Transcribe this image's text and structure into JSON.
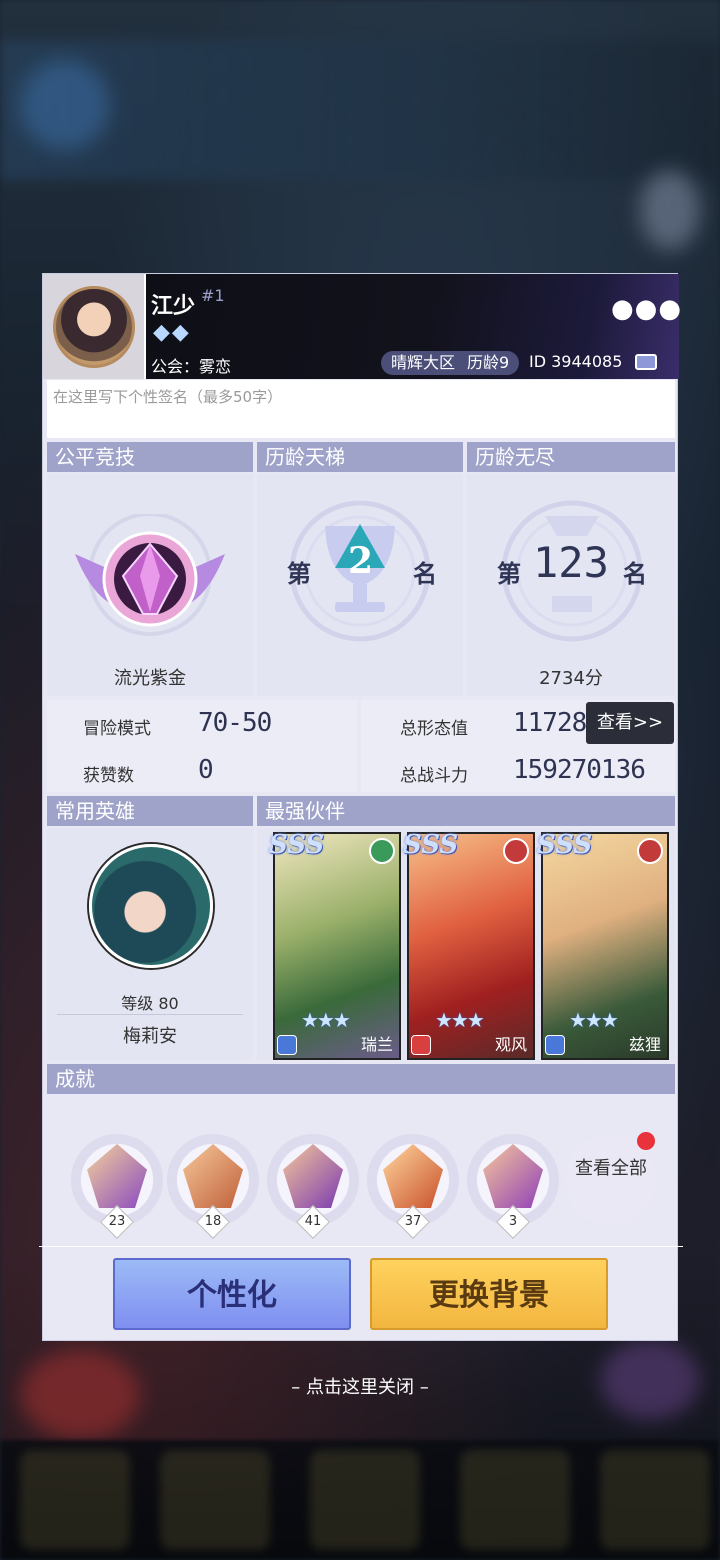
{
  "profile": {
    "name": "江少",
    "rank_no": "#1",
    "guild": "公会：雾恋",
    "server": "晴辉大区",
    "seasons": "历龄9",
    "user_id": "ID 3944085",
    "more_icon": "more-dots-icon",
    "signature_placeholder": "在这里写下个性签名（最多50字）"
  },
  "ranking": {
    "fair_title": "公平竞技",
    "ladder_title": "历龄天梯",
    "endless_title": "历龄无尽",
    "fair_tier": "流光紫金",
    "ladder_prefix": "第",
    "ladder_rank": "2",
    "ladder_suffix": "名",
    "endless_prefix": "第",
    "endless_rank": "123",
    "endless_suffix": "名",
    "endless_score": "2734分"
  },
  "stats": {
    "adventure_label": "冒险模式",
    "adventure_value": "70-50",
    "likes_label": "获赞数",
    "likes_value": "0",
    "forms_label": "总形态值",
    "forms_value": "11728",
    "power_label": "总战斗力",
    "power_value": "159270136",
    "view_button": "查看>>"
  },
  "heroes": {
    "common_title": "常用英雄",
    "strongest_title": "最强伙伴",
    "hero_level": "等级 80",
    "hero_name": "梅莉安",
    "partners": [
      {
        "grade": "SSS",
        "name": "瑞兰",
        "stars": "★★★",
        "elem_color": "#3a9a5a",
        "badge_color": "#4a78d8"
      },
      {
        "grade": "SSS",
        "name": "观风",
        "stars": "★★★",
        "elem_color": "#c23a3a",
        "badge_color": "#d84040"
      },
      {
        "grade": "SSS",
        "name": "兹狸",
        "stars": "★★★",
        "elem_color": "#c23a3a",
        "badge_color": "#4a78d8"
      }
    ]
  },
  "achievements": {
    "title": "成就",
    "items": [
      {
        "icon": "tower-achievement-icon",
        "count": "23"
      },
      {
        "icon": "swords-achievement-icon",
        "count": "18"
      },
      {
        "icon": "crest-achievement-icon",
        "count": "41"
      },
      {
        "icon": "flame-achievement-icon",
        "count": "37"
      },
      {
        "icon": "wings-achievement-icon",
        "count": "3"
      }
    ],
    "view_all": "查看全部"
  },
  "actions": {
    "personalize": "个性化",
    "change_background": "更换背景"
  },
  "close_hint": "– 点击这里关闭 –"
}
